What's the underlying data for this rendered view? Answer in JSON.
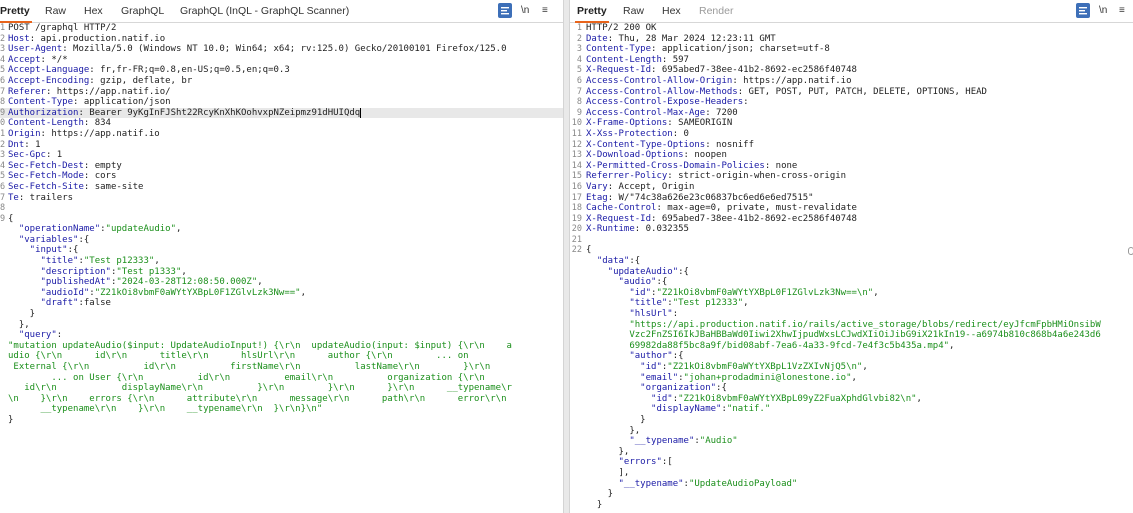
{
  "request": {
    "tabs": [
      "Pretty",
      "Raw",
      "Hex",
      "GraphQL",
      "GraphQL (InQL - GraphQL Scanner)"
    ],
    "active_tab": "Pretty",
    "toolbar": {
      "wrap": "\\n",
      "menu": "≡"
    },
    "lines": [
      {
        "n": "1",
        "parts": [
          {
            "t": "POST /graphql HTTP/2",
            "c": "o"
          }
        ]
      },
      {
        "n": "2",
        "parts": [
          {
            "t": "Host",
            "c": "k"
          },
          {
            "t": ": api.production.natif.io",
            "c": "o"
          }
        ]
      },
      {
        "n": "3",
        "parts": [
          {
            "t": "User-Agent",
            "c": "k"
          },
          {
            "t": ": Mozilla/5.0 (Windows NT 10.0; Win64; x64; rv:125.0) Gecko/20100101 Firefox/125.0",
            "c": "o"
          }
        ]
      },
      {
        "n": "4",
        "parts": [
          {
            "t": "Accept",
            "c": "k"
          },
          {
            "t": ": */*",
            "c": "o"
          }
        ]
      },
      {
        "n": "5",
        "parts": [
          {
            "t": "Accept-Language",
            "c": "k"
          },
          {
            "t": ": fr,fr-FR;q=0.8,en-US;q=0.5,en;q=0.3",
            "c": "o"
          }
        ]
      },
      {
        "n": "6",
        "parts": [
          {
            "t": "Accept-Encoding",
            "c": "k"
          },
          {
            "t": ": gzip, deflate, br",
            "c": "o"
          }
        ]
      },
      {
        "n": "7",
        "parts": [
          {
            "t": "Referer",
            "c": "k"
          },
          {
            "t": ": https://app.natif.io/",
            "c": "o"
          }
        ]
      },
      {
        "n": "8",
        "parts": [
          {
            "t": "Content-Type",
            "c": "k"
          },
          {
            "t": ": application/json",
            "c": "o"
          }
        ]
      },
      {
        "n": "9",
        "hl": true,
        "parts": [
          {
            "t": "Authorization",
            "c": "k"
          },
          {
            "t": ": Bearer 9yKgInFJSht22RcyKnXhKOohvxpNZeipmz91dHUIQdq",
            "c": "o"
          }
        ]
      },
      {
        "n": "0",
        "parts": [
          {
            "t": "Content-Length",
            "c": "k"
          },
          {
            "t": ": 834",
            "c": "o"
          }
        ]
      },
      {
        "n": "1",
        "parts": [
          {
            "t": "Origin",
            "c": "k"
          },
          {
            "t": ": https://app.natif.io",
            "c": "o"
          }
        ]
      },
      {
        "n": "2",
        "parts": [
          {
            "t": "Dnt",
            "c": "k"
          },
          {
            "t": ": 1",
            "c": "o"
          }
        ]
      },
      {
        "n": "3",
        "parts": [
          {
            "t": "Sec-Gpc",
            "c": "k"
          },
          {
            "t": ": 1",
            "c": "o"
          }
        ]
      },
      {
        "n": "4",
        "parts": [
          {
            "t": "Sec-Fetch-Dest",
            "c": "k"
          },
          {
            "t": ": empty",
            "c": "o"
          }
        ]
      },
      {
        "n": "5",
        "parts": [
          {
            "t": "Sec-Fetch-Mode",
            "c": "k"
          },
          {
            "t": ": cors",
            "c": "o"
          }
        ]
      },
      {
        "n": "6",
        "parts": [
          {
            "t": "Sec-Fetch-Site",
            "c": "k"
          },
          {
            "t": ": same-site",
            "c": "o"
          }
        ]
      },
      {
        "n": "7",
        "parts": [
          {
            "t": "Te",
            "c": "k"
          },
          {
            "t": ": trailers",
            "c": "o"
          }
        ]
      },
      {
        "n": "8",
        "parts": []
      },
      {
        "n": "9",
        "parts": [
          {
            "t": "{",
            "c": "o"
          }
        ]
      },
      {
        "n": "",
        "parts": [
          {
            "t": "  \"operationName\"",
            "c": "k"
          },
          {
            "t": ":",
            "c": "o"
          },
          {
            "t": "\"updateAudio\"",
            "c": "s"
          },
          {
            "t": ",",
            "c": "o"
          }
        ]
      },
      {
        "n": "",
        "parts": [
          {
            "t": "  \"variables\"",
            "c": "k"
          },
          {
            "t": ":{",
            "c": "o"
          }
        ]
      },
      {
        "n": "",
        "parts": [
          {
            "t": "    \"input\"",
            "c": "k"
          },
          {
            "t": ":{",
            "c": "o"
          }
        ]
      },
      {
        "n": "",
        "parts": [
          {
            "t": "      \"title\"",
            "c": "k"
          },
          {
            "t": ":",
            "c": "o"
          },
          {
            "t": "\"Test p12333\"",
            "c": "s"
          },
          {
            "t": ",",
            "c": "o"
          }
        ]
      },
      {
        "n": "",
        "parts": [
          {
            "t": "      \"description\"",
            "c": "k"
          },
          {
            "t": ":",
            "c": "o"
          },
          {
            "t": "\"Test p1333\"",
            "c": "s"
          },
          {
            "t": ",",
            "c": "o"
          }
        ]
      },
      {
        "n": "",
        "parts": [
          {
            "t": "      \"publishedAt\"",
            "c": "k"
          },
          {
            "t": ":",
            "c": "o"
          },
          {
            "t": "\"2024-03-28T12:08:50.000Z\"",
            "c": "s"
          },
          {
            "t": ",",
            "c": "o"
          }
        ]
      },
      {
        "n": "",
        "parts": [
          {
            "t": "      \"audioId\"",
            "c": "k"
          },
          {
            "t": ":",
            "c": "o"
          },
          {
            "t": "\"Z21kOi8vbmF0aWYtYXBpL0F1ZGlvLzk3Nw==\"",
            "c": "s"
          },
          {
            "t": ",",
            "c": "o"
          }
        ]
      },
      {
        "n": "",
        "parts": [
          {
            "t": "      \"draft\"",
            "c": "k"
          },
          {
            "t": ":false",
            "c": "o"
          }
        ]
      },
      {
        "n": "",
        "parts": [
          {
            "t": "    }",
            "c": "o"
          }
        ]
      },
      {
        "n": "",
        "parts": [
          {
            "t": "  },",
            "c": "o"
          }
        ]
      },
      {
        "n": "",
        "parts": [
          {
            "t": "  \"query\"",
            "c": "k"
          },
          {
            "t": ":",
            "c": "o"
          }
        ]
      },
      {
        "n": "",
        "parts": [
          {
            "t": "\"mutation updateAudio($input: UpdateAudioInput!) {\\r\\n  updateAudio(input: $input) {\\r\\n    a",
            "c": "s"
          }
        ]
      },
      {
        "n": "",
        "parts": [
          {
            "t": "udio {\\r\\n      id\\r\\n      title\\r\\n      hlsUrl\\r\\n      author {\\r\\n        ... on",
            "c": "s"
          }
        ]
      },
      {
        "n": "",
        "parts": [
          {
            "t": " External {\\r\\n          id\\r\\n          firstName\\r\\n          lastName\\r\\n        }\\r\\n",
            "c": "s"
          }
        ]
      },
      {
        "n": "",
        "parts": [
          {
            "t": "        ... on User {\\r\\n          id\\r\\n          email\\r\\n          organization {\\r\\n",
            "c": "s"
          }
        ]
      },
      {
        "n": "",
        "parts": [
          {
            "t": "   id\\r\\n            displayName\\r\\n          }\\r\\n        }\\r\\n      }\\r\\n      __typename\\r",
            "c": "s"
          }
        ]
      },
      {
        "n": "",
        "parts": [
          {
            "t": "\\n    }\\r\\n    errors {\\r\\n      attribute\\r\\n      message\\r\\n      path\\r\\n      error\\r\\n",
            "c": "s"
          }
        ]
      },
      {
        "n": "",
        "parts": [
          {
            "t": "      __typename\\r\\n    }\\r\\n    __typename\\r\\n  }\\r\\n}\\n\"",
            "c": "s"
          }
        ]
      },
      {
        "n": "",
        "parts": [
          {
            "t": "}",
            "c": "o"
          }
        ]
      }
    ]
  },
  "response": {
    "tabs": [
      "Pretty",
      "Raw",
      "Hex",
      "Render"
    ],
    "active_tab": "Pretty",
    "disabled_tab": "Render",
    "toolbar": {
      "wrap": "\\n",
      "menu": "≡"
    },
    "lines": [
      {
        "n": "1",
        "parts": [
          {
            "t": "HTTP/2 200 OK",
            "c": "o"
          }
        ]
      },
      {
        "n": "2",
        "parts": [
          {
            "t": "Date",
            "c": "k"
          },
          {
            "t": ": Thu, 28 Mar 2024 12:23:11 GMT",
            "c": "o"
          }
        ]
      },
      {
        "n": "3",
        "parts": [
          {
            "t": "Content-Type",
            "c": "k"
          },
          {
            "t": ": application/json; charset=utf-8",
            "c": "o"
          }
        ]
      },
      {
        "n": "4",
        "parts": [
          {
            "t": "Content-Length",
            "c": "k"
          },
          {
            "t": ": 597",
            "c": "o"
          }
        ]
      },
      {
        "n": "5",
        "parts": [
          {
            "t": "X-Request-Id",
            "c": "k"
          },
          {
            "t": ": 695abed7-38ee-41b2-8692-ec2586f40748",
            "c": "o"
          }
        ]
      },
      {
        "n": "6",
        "parts": [
          {
            "t": "Access-Control-Allow-Origin",
            "c": "k"
          },
          {
            "t": ": https://app.natif.io",
            "c": "o"
          }
        ]
      },
      {
        "n": "7",
        "parts": [
          {
            "t": "Access-Control-Allow-Methods",
            "c": "k"
          },
          {
            "t": ": GET, POST, PUT, PATCH, DELETE, OPTIONS, HEAD",
            "c": "o"
          }
        ]
      },
      {
        "n": "8",
        "parts": [
          {
            "t": "Access-Control-Expose-Headers",
            "c": "k"
          },
          {
            "t": ":",
            "c": "o"
          }
        ]
      },
      {
        "n": "9",
        "parts": [
          {
            "t": "Access-Control-Max-Age",
            "c": "k"
          },
          {
            "t": ": 7200",
            "c": "o"
          }
        ]
      },
      {
        "n": "10",
        "parts": [
          {
            "t": "X-Frame-Options",
            "c": "k"
          },
          {
            "t": ": SAMEORIGIN",
            "c": "o"
          }
        ]
      },
      {
        "n": "11",
        "parts": [
          {
            "t": "X-Xss-Protection",
            "c": "k"
          },
          {
            "t": ": 0",
            "c": "o"
          }
        ]
      },
      {
        "n": "12",
        "parts": [
          {
            "t": "X-Content-Type-Options",
            "c": "k"
          },
          {
            "t": ": nosniff",
            "c": "o"
          }
        ]
      },
      {
        "n": "13",
        "parts": [
          {
            "t": "X-Download-Options",
            "c": "k"
          },
          {
            "t": ": noopen",
            "c": "o"
          }
        ]
      },
      {
        "n": "14",
        "parts": [
          {
            "t": "X-Permitted-Cross-Domain-Policies",
            "c": "k"
          },
          {
            "t": ": none",
            "c": "o"
          }
        ]
      },
      {
        "n": "15",
        "parts": [
          {
            "t": "Referrer-Policy",
            "c": "k"
          },
          {
            "t": ": strict-origin-when-cross-origin",
            "c": "o"
          }
        ]
      },
      {
        "n": "16",
        "parts": [
          {
            "t": "Vary",
            "c": "k"
          },
          {
            "t": ": Accept, Origin",
            "c": "o"
          }
        ]
      },
      {
        "n": "17",
        "parts": [
          {
            "t": "Etag",
            "c": "k"
          },
          {
            "t": ": W/\"74c38a626e23c06837bc6ed6e6ed7515\"",
            "c": "o"
          }
        ]
      },
      {
        "n": "18",
        "parts": [
          {
            "t": "Cache-Control",
            "c": "k"
          },
          {
            "t": ": max-age=0, private, must-revalidate",
            "c": "o"
          }
        ]
      },
      {
        "n": "19",
        "parts": [
          {
            "t": "X-Request-Id",
            "c": "k"
          },
          {
            "t": ": 695abed7-38ee-41b2-8692-ec2586f40748",
            "c": "o"
          }
        ]
      },
      {
        "n": "20",
        "parts": [
          {
            "t": "X-Runtime",
            "c": "k"
          },
          {
            "t": ": 0.032355",
            "c": "o"
          }
        ]
      },
      {
        "n": "21",
        "parts": []
      },
      {
        "n": "22",
        "parts": [
          {
            "t": "{",
            "c": "o"
          }
        ]
      },
      {
        "n": "",
        "parts": [
          {
            "t": "  \"data\"",
            "c": "k"
          },
          {
            "t": ":{",
            "c": "o"
          }
        ]
      },
      {
        "n": "",
        "parts": [
          {
            "t": "    \"updateAudio\"",
            "c": "k"
          },
          {
            "t": ":{",
            "c": "o"
          }
        ]
      },
      {
        "n": "",
        "parts": [
          {
            "t": "      \"audio\"",
            "c": "k"
          },
          {
            "t": ":{",
            "c": "o"
          }
        ]
      },
      {
        "n": "",
        "parts": [
          {
            "t": "        \"id\"",
            "c": "k"
          },
          {
            "t": ":",
            "c": "o"
          },
          {
            "t": "\"Z21kOi8vbmF0aWYtYXBpL0F1ZGlvLzk3Nw==\\n\"",
            "c": "s"
          },
          {
            "t": ",",
            "c": "o"
          }
        ]
      },
      {
        "n": "",
        "parts": [
          {
            "t": "        \"title\"",
            "c": "k"
          },
          {
            "t": ":",
            "c": "o"
          },
          {
            "t": "\"Test p12333\"",
            "c": "s"
          },
          {
            "t": ",",
            "c": "o"
          }
        ]
      },
      {
        "n": "",
        "parts": [
          {
            "t": "        \"hlsUrl\"",
            "c": "k"
          },
          {
            "t": ":",
            "c": "o"
          }
        ]
      },
      {
        "n": "",
        "parts": [
          {
            "t": "        \"https://api.production.natif.io/rails/active_storage/blobs/redirect/eyJfcmFpbHMiOnsibW",
            "c": "s"
          }
        ]
      },
      {
        "n": "",
        "parts": [
          {
            "t": "        Vzc2FnZSI6IkJBaHBBaWd0Iiwi2XhwIjpudWxsLCJwdXIiOiJibG9iX21kIn19--a6974b810c868b4a6e243d6",
            "c": "s"
          }
        ]
      },
      {
        "n": "",
        "parts": [
          {
            "t": "        69982da88f5bc8a9f/bid08abf-7ea6-4a33-9fcd-7e4f3c5b435a.mp4\"",
            "c": "s"
          },
          {
            "t": ",",
            "c": "o"
          }
        ]
      },
      {
        "n": "",
        "parts": [
          {
            "t": "        \"author\"",
            "c": "k"
          },
          {
            "t": ":{",
            "c": "o"
          }
        ]
      },
      {
        "n": "",
        "parts": [
          {
            "t": "          \"id\"",
            "c": "k"
          },
          {
            "t": ":",
            "c": "o"
          },
          {
            "t": "\"Z21kOi8vbmF0aWYtYXBpL1VzZXIvNjQ5\\n\"",
            "c": "s"
          },
          {
            "t": ",",
            "c": "o"
          }
        ]
      },
      {
        "n": "",
        "parts": [
          {
            "t": "          \"email\"",
            "c": "k"
          },
          {
            "t": ":",
            "c": "o"
          },
          {
            "t": "\"johan+prodadmini@lonestone.io\"",
            "c": "s"
          },
          {
            "t": ",",
            "c": "o"
          }
        ]
      },
      {
        "n": "",
        "parts": [
          {
            "t": "          \"organization\"",
            "c": "k"
          },
          {
            "t": ":{",
            "c": "o"
          }
        ]
      },
      {
        "n": "",
        "parts": [
          {
            "t": "            \"id\"",
            "c": "k"
          },
          {
            "t": ":",
            "c": "o"
          },
          {
            "t": "\"Z21kOi8vbmF0aWYtYXBpL09yZ2FuaXphdGlvbi82\\n\"",
            "c": "s"
          },
          {
            "t": ",",
            "c": "o"
          }
        ]
      },
      {
        "n": "",
        "parts": [
          {
            "t": "            \"displayName\"",
            "c": "k"
          },
          {
            "t": ":",
            "c": "o"
          },
          {
            "t": "\"natif.\"",
            "c": "s"
          }
        ]
      },
      {
        "n": "",
        "parts": [
          {
            "t": "          }",
            "c": "o"
          }
        ]
      },
      {
        "n": "",
        "parts": [
          {
            "t": "        },",
            "c": "o"
          }
        ]
      },
      {
        "n": "",
        "parts": [
          {
            "t": "        \"__typename\"",
            "c": "k"
          },
          {
            "t": ":",
            "c": "o"
          },
          {
            "t": "\"Audio\"",
            "c": "s"
          }
        ]
      },
      {
        "n": "",
        "parts": [
          {
            "t": "      },",
            "c": "o"
          }
        ]
      },
      {
        "n": "",
        "parts": [
          {
            "t": "      \"errors\"",
            "c": "k"
          },
          {
            "t": ":[",
            "c": "o"
          }
        ]
      },
      {
        "n": "",
        "parts": [
          {
            "t": "      ],",
            "c": "o"
          }
        ]
      },
      {
        "n": "",
        "parts": [
          {
            "t": "      \"__typename\"",
            "c": "k"
          },
          {
            "t": ":",
            "c": "o"
          },
          {
            "t": "\"UpdateAudioPayload\"",
            "c": "s"
          }
        ]
      },
      {
        "n": "",
        "parts": [
          {
            "t": "    }",
            "c": "o"
          }
        ]
      },
      {
        "n": "",
        "parts": [
          {
            "t": "  }",
            "c": "o"
          }
        ]
      }
    ]
  }
}
